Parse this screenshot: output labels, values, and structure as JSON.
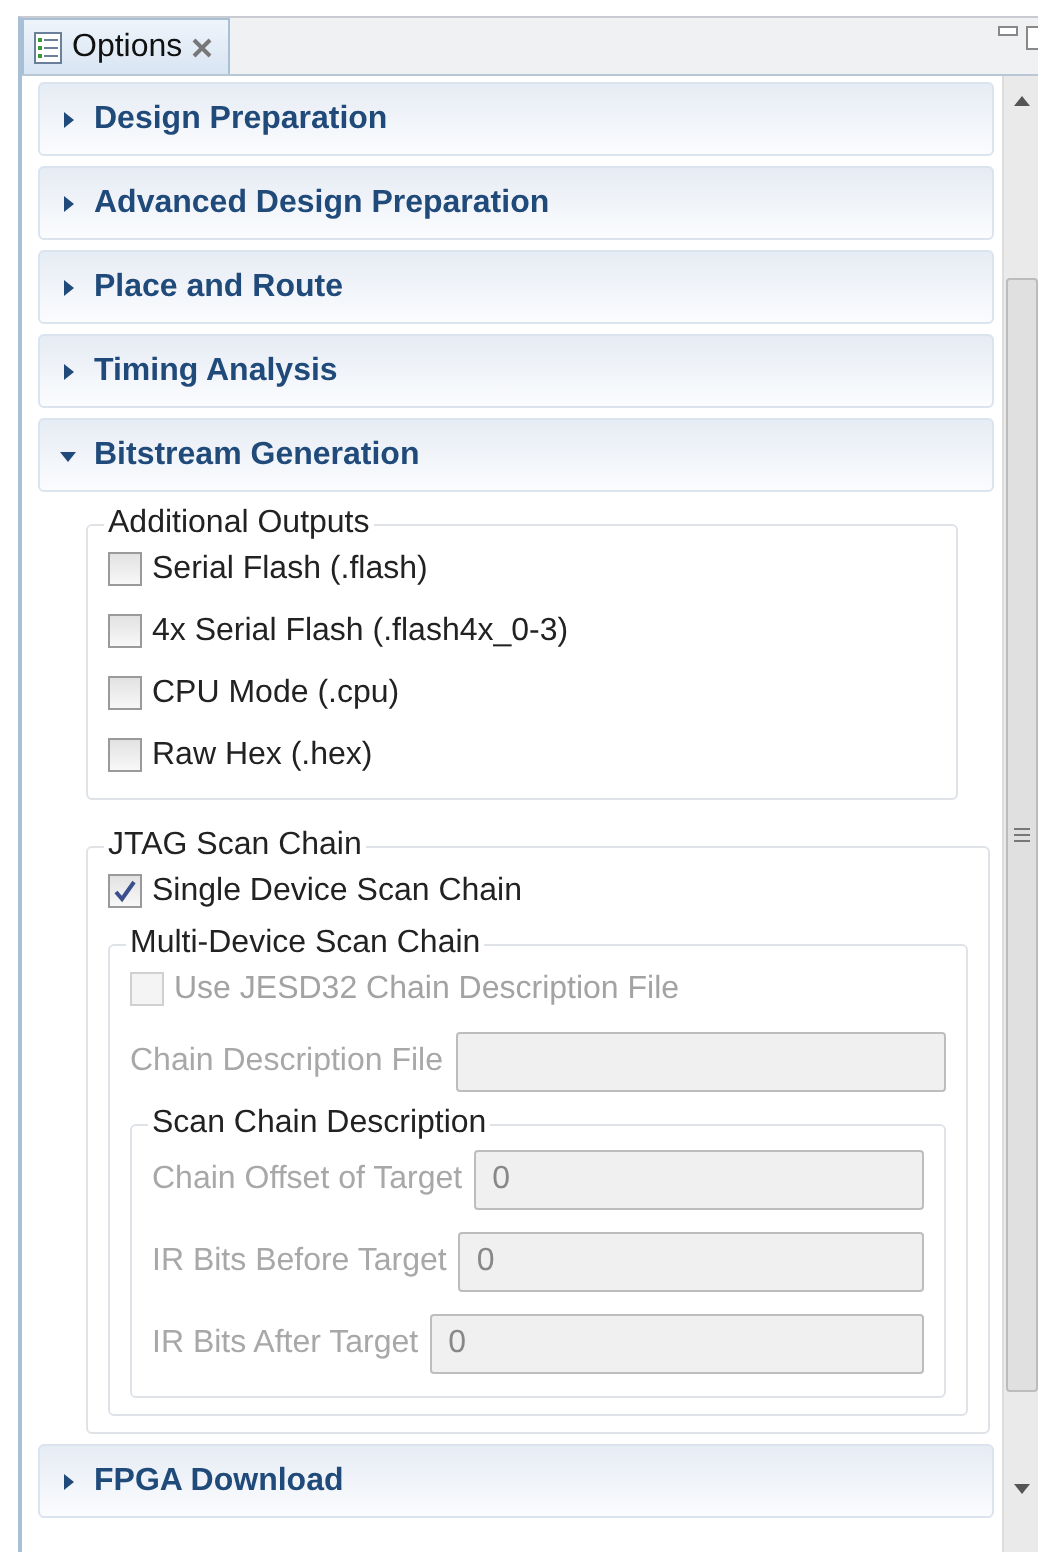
{
  "tab": {
    "title": "Options"
  },
  "sections": [
    {
      "title": "Design Preparation",
      "expanded": false
    },
    {
      "title": "Advanced Design Preparation",
      "expanded": false
    },
    {
      "title": "Place and Route",
      "expanded": false
    },
    {
      "title": "Timing Analysis",
      "expanded": false
    },
    {
      "title": "Bitstream Generation",
      "expanded": true,
      "content": [
        {
          "kind": "group",
          "title": "Additional Outputs",
          "items": [
            {
              "kind": "checkbox",
              "label": "Serial Flash (.flash)",
              "checked": false,
              "disabled": false
            },
            {
              "kind": "checkbox",
              "label": "4x Serial Flash (.flash4x_0-3)",
              "checked": false,
              "disabled": false
            },
            {
              "kind": "checkbox",
              "label": "CPU Mode (.cpu)",
              "checked": false,
              "disabled": false
            },
            {
              "kind": "checkbox",
              "label": "Raw Hex (.hex)",
              "checked": false,
              "disabled": false
            }
          ]
        },
        {
          "kind": "group",
          "title": "JTAG Scan Chain",
          "items": [
            {
              "kind": "checkbox",
              "label": "Single Device Scan Chain",
              "checked": true,
              "disabled": false
            },
            {
              "kind": "group",
              "title": "Multi-Device Scan Chain",
              "items": [
                {
                  "kind": "checkbox",
                  "label": "Use JESD32 Chain Description File",
                  "checked": false,
                  "disabled": true
                },
                {
                  "kind": "field",
                  "label": "Chain Description File",
                  "disabled": true
                },
                {
                  "kind": "group",
                  "title": "Scan Chain Description",
                  "items": [
                    {
                      "kind": "field",
                      "label": "Chain Offset of Target",
                      "value": "0",
                      "disabled": true
                    },
                    {
                      "kind": "field",
                      "label": "IR Bits Before Target",
                      "value": "0",
                      "disabled": true
                    },
                    {
                      "kind": "field",
                      "label": "IR Bits After Target",
                      "value": "0",
                      "disabled": true
                    }
                  ]
                }
              ]
            }
          ]
        }
      ]
    },
    {
      "title": "FPGA Download",
      "expanded": false
    }
  ]
}
